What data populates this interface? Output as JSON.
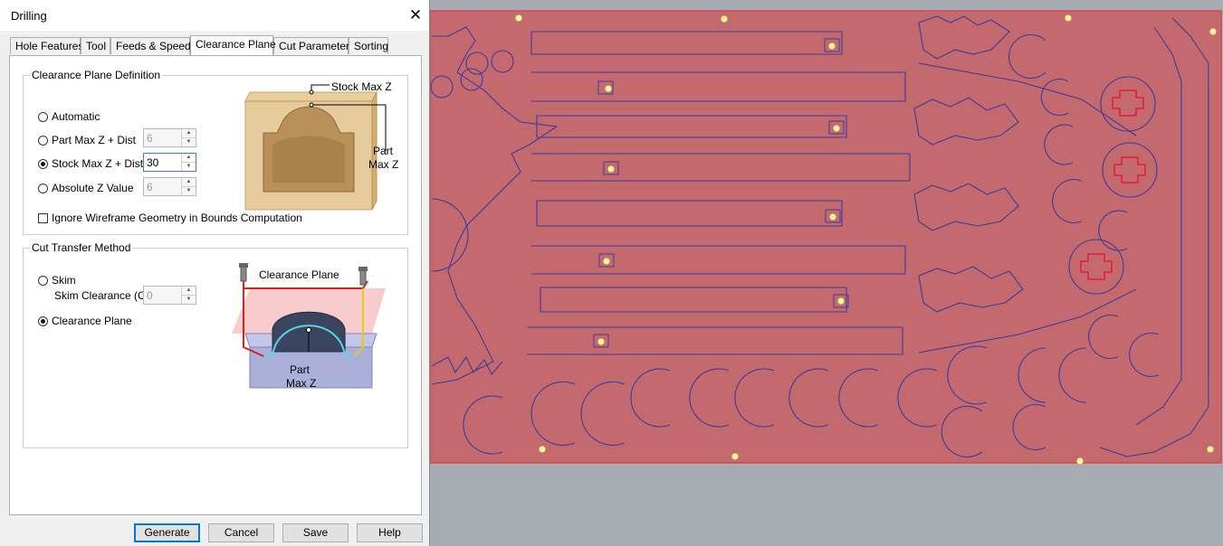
{
  "dialog": {
    "title": "Drilling",
    "close_glyph": "✕",
    "tabs": [
      {
        "label": "Hole Features",
        "active": false
      },
      {
        "label": "Tool",
        "active": false
      },
      {
        "label": "Feeds & Speeds",
        "active": false
      },
      {
        "label": "Clearance Plane",
        "active": true
      },
      {
        "label": "Cut Parameters",
        "active": false
      },
      {
        "label": "Sorting",
        "active": false
      }
    ],
    "clearance_definition": {
      "group_label": "Clearance Plane Definition",
      "options": [
        {
          "label": "Automatic",
          "checked": false
        },
        {
          "label": "Part Max Z + Dist",
          "checked": false,
          "value": "6",
          "enabled": false
        },
        {
          "label": "Stock Max Z + Dist",
          "checked": true,
          "value": "30",
          "enabled": true
        },
        {
          "label": "Absolute Z Value",
          "checked": false,
          "value": "6",
          "enabled": false
        }
      ],
      "ignore_wireframe": {
        "label": "Ignore Wireframe Geometry in Bounds Computation",
        "checked": false
      },
      "figure": {
        "stock_max_z_label": "Stock Max Z",
        "part_label": "Part",
        "max_z_label": "Max Z"
      }
    },
    "cut_transfer": {
      "group_label": "Cut Transfer Method",
      "skim": {
        "label": "Skim",
        "checked": false
      },
      "skim_clearance": {
        "label": "Skim Clearance (C)",
        "value": "0",
        "enabled": false
      },
      "clearance_plane": {
        "label": "Clearance Plane",
        "checked": true
      },
      "figure": {
        "clearance_plane_label": "Clearance Plane",
        "part_label": "Part",
        "max_z_label": "Max Z"
      }
    },
    "buttons": {
      "generate": "Generate",
      "cancel": "Cancel",
      "save": "Save",
      "help": "Help"
    }
  },
  "viewport": {
    "stock_color": "#c46a6e",
    "toolpath_color": "#3b3b9c",
    "hole_marker_color": "#fff59a",
    "cross_color": "#e0203a"
  }
}
